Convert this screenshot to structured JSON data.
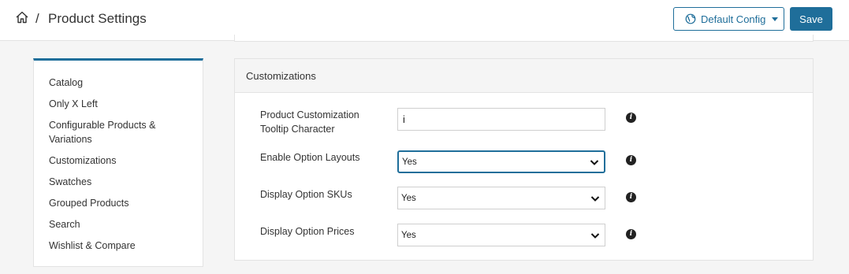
{
  "header": {
    "breadcrumb_separator": "/",
    "title": "Product Settings",
    "config_label": "Default Config",
    "save_label": "Save"
  },
  "sidebar": {
    "items": [
      {
        "label": "Catalog"
      },
      {
        "label": "Only X Left"
      },
      {
        "label": "Configurable Products & Variations"
      },
      {
        "label": "Customizations"
      },
      {
        "label": "Swatches"
      },
      {
        "label": "Grouped Products"
      },
      {
        "label": "Search"
      },
      {
        "label": "Wishlist & Compare"
      }
    ]
  },
  "panel": {
    "title": "Customizations",
    "fields": [
      {
        "label": "Product Customization Tooltip Character",
        "value": "i"
      },
      {
        "label": "Enable Option Layouts",
        "value": "Yes"
      },
      {
        "label": "Display Option SKUs",
        "value": "Yes"
      },
      {
        "label": "Display Option Prices",
        "value": "Yes"
      }
    ],
    "info_glyph": "i"
  },
  "colors": {
    "accent": "#1f6e9a",
    "background": "#f5f5f5"
  },
  "icons": [
    "home-icon",
    "globe-icon",
    "caret-down-icon",
    "chevron-down-icon",
    "info-icon"
  ]
}
